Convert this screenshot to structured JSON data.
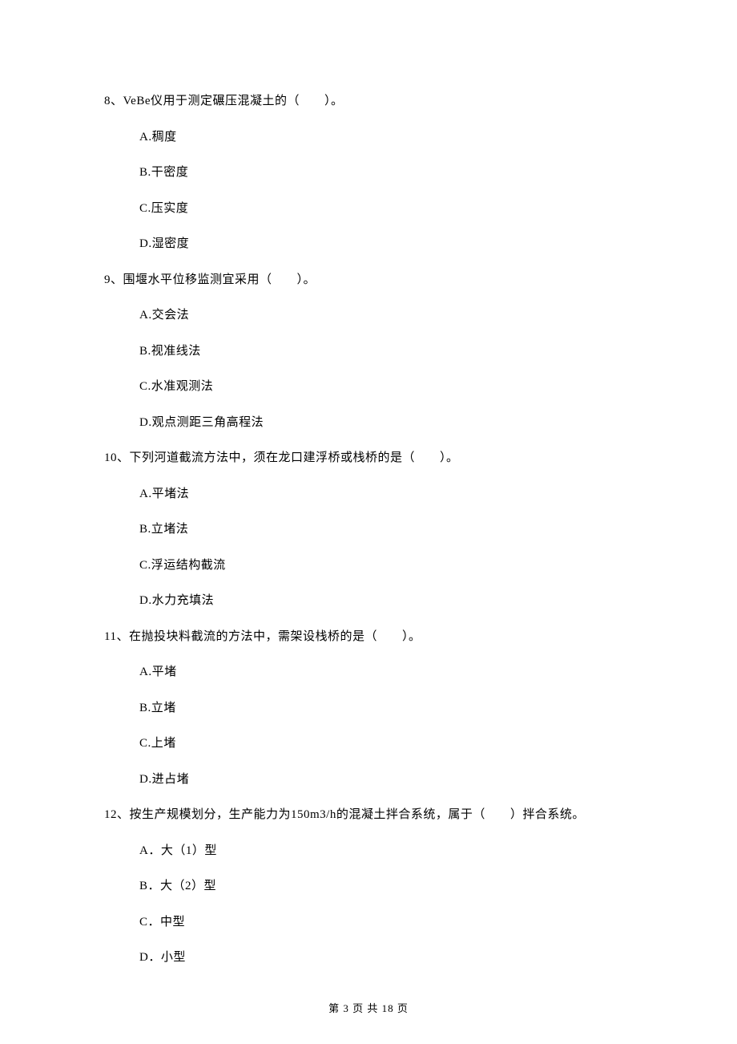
{
  "questions": [
    {
      "number": "8、",
      "text": "VeBe仪用于测定碾压混凝土的（　　）。",
      "options": [
        "A.稠度",
        "B.干密度",
        "C.压实度",
        "D.湿密度"
      ]
    },
    {
      "number": "9、",
      "text": "围堰水平位移监测宜采用（　　）。",
      "options": [
        "A.交会法",
        "B.视准线法",
        "C.水准观测法",
        "D.观点测距三角高程法"
      ]
    },
    {
      "number": "10、",
      "text": "下列河道截流方法中，须在龙口建浮桥或栈桥的是（　　）。",
      "options": [
        "A.平堵法",
        "B.立堵法",
        "C.浮运结构截流",
        "D.水力充填法"
      ]
    },
    {
      "number": "11、",
      "text": "在抛投块料截流的方法中，需架设栈桥的是（　　）。",
      "options": [
        "A.平堵",
        "B.立堵",
        "C.上堵",
        "D.进占堵"
      ]
    },
    {
      "number": "12、",
      "text": "按生产规模划分，生产能力为150m3/h的混凝土拌合系统，属于（　　）拌合系统。",
      "options": [
        "A．大（1）型",
        "B．大（2）型",
        "C．中型",
        "D．小型"
      ]
    }
  ],
  "footer": "第 3 页 共 18 页"
}
